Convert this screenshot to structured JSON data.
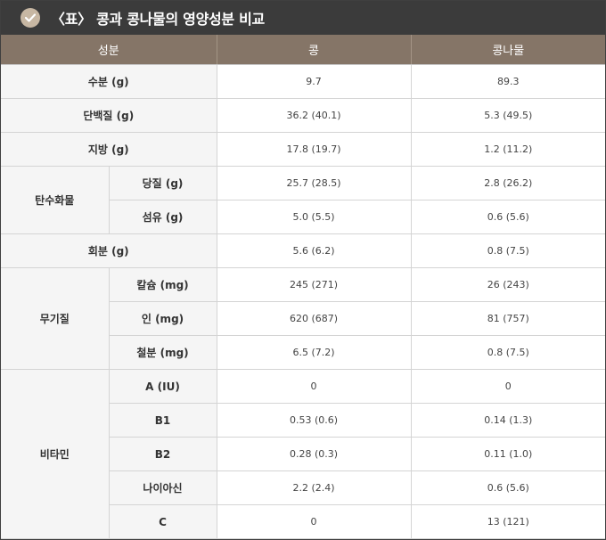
{
  "title": "〈표〉 콩과 콩나물의 영양성분 비교",
  "header": {
    "col1": "성분",
    "col2": "콩",
    "col3": "콩나물"
  },
  "rows": {
    "moisture": {
      "label": "수분 (g)",
      "bean": "9.7",
      "sprout": "89.3"
    },
    "protein": {
      "label": "단백질 (g)",
      "bean": "36.2 (40.1)",
      "sprout": "5.3 (49.5)"
    },
    "fat": {
      "label": "지방 (g)",
      "bean": "17.8 (19.7)",
      "sprout": "1.2 (11.2)"
    },
    "carb_group": "탄수화물",
    "sugar": {
      "label": "당질 (g)",
      "bean": "25.7 (28.5)",
      "sprout": "2.8 (26.2)"
    },
    "fiber": {
      "label": "섬유 (g)",
      "bean": "5.0 (5.5)",
      "sprout": "0.6 (5.6)"
    },
    "ash": {
      "label": "회분 (g)",
      "bean": "5.6 (6.2)",
      "sprout": "0.8 (7.5)"
    },
    "mineral_group": "무기질",
    "calcium": {
      "label": "칼슘 (mg)",
      "bean": "245 (271)",
      "sprout": "26 (243)"
    },
    "phosphorus": {
      "label": "인 (mg)",
      "bean": "620 (687)",
      "sprout": "81 (757)"
    },
    "iron": {
      "label": "철분 (mg)",
      "bean": "6.5 (7.2)",
      "sprout": "0.8 (7.5)"
    },
    "vitamin_group": "비타민",
    "vit_a": {
      "label": "A (IU)",
      "bean": "0",
      "sprout": "0"
    },
    "vit_b1": {
      "label": "B1",
      "bean": "0.53 (0.6)",
      "sprout": "0.14 (1.3)"
    },
    "vit_b2": {
      "label": "B2",
      "bean": "0.28 (0.3)",
      "sprout": "0.11 (1.0)"
    },
    "niacin": {
      "label": "나이아신",
      "bean": "2.2 (2.4)",
      "sprout": "0.6 (5.6)"
    },
    "vit_c": {
      "label": "C",
      "bean": "0",
      "sprout": "13 (121)"
    }
  },
  "colors": {
    "titlebar": "#3b3b3b",
    "header": "#857567",
    "badge": "#c7b7a3",
    "label_bg": "#f5f5f5"
  },
  "icons": {
    "title_badge": "check-circle-icon"
  }
}
